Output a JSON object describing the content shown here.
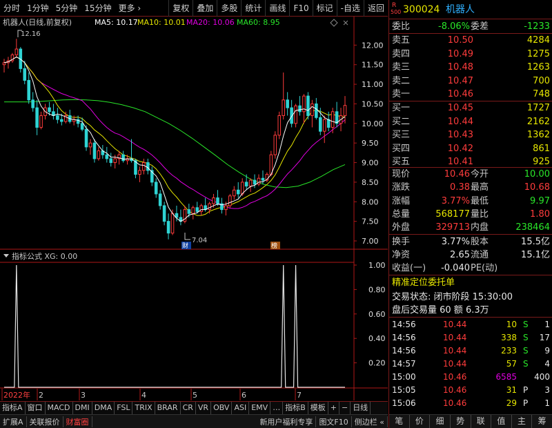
{
  "toolbar": {
    "left": [
      "分时",
      "1分钟",
      "5分钟",
      "15分钟",
      "更多 ›"
    ],
    "right": [
      "复权",
      "叠加",
      "多股",
      "统计",
      "画线",
      "F10",
      "标记",
      "-自选",
      "返回"
    ]
  },
  "chart": {
    "title": "机器人(日线,前复权)",
    "ma_labels": [
      {
        "text": "MA5: 10.17",
        "color": "#ffffff"
      },
      {
        "text": "MA10: 10.01",
        "color": "#e6e600"
      },
      {
        "text": "MA20: 10.06",
        "color": "#e000e0"
      },
      {
        "text": "MA60: 8.95",
        "color": "#29e629"
      }
    ],
    "high_mark": "12.16",
    "low_mark": "7.04",
    "badge1": "财",
    "badge2": "榜",
    "indicator_title": "指标公式 XG: 0.00",
    "price_ticks": [
      "12.00",
      "11.50",
      "11.00",
      "10.50",
      "10.00",
      "9.50",
      "9.00",
      "8.50",
      "8.00",
      "7.50",
      "7.00"
    ],
    "ind_ticks": [
      "1.00",
      "0.80",
      "0.60",
      "0.40",
      "0.20"
    ],
    "date_labels": [
      "2022年",
      "2",
      "3",
      "4",
      "5",
      "6",
      "7"
    ],
    "colors": {
      "up": "#ff3c3c",
      "down": "#2fd3d3",
      "ma5": "#ffffff",
      "ma10": "#e6e600",
      "ma20": "#e000e0",
      "ma60": "#29e629",
      "axis": "#b01818"
    }
  },
  "chart_data": {
    "type": "candlestick",
    "title": "机器人(日线,前复权)",
    "ylim": [
      7.0,
      12.2
    ],
    "candles": [
      [
        11.5,
        11.65,
        11.3,
        11.55
      ],
      [
        11.55,
        11.7,
        11.4,
        11.6
      ],
      [
        11.6,
        11.8,
        11.55,
        11.75
      ],
      [
        11.75,
        12.16,
        11.7,
        11.9
      ],
      [
        11.9,
        11.95,
        11.3,
        11.4
      ],
      [
        11.4,
        11.6,
        11.0,
        11.1
      ],
      [
        11.1,
        11.3,
        10.5,
        10.6
      ],
      [
        10.6,
        10.8,
        10.3,
        10.4
      ],
      [
        10.4,
        10.6,
        9.7,
        9.9
      ],
      [
        9.9,
        10.3,
        9.85,
        10.2
      ],
      [
        10.2,
        10.5,
        10.1,
        10.4
      ],
      [
        10.4,
        10.55,
        10.2,
        10.3
      ],
      [
        10.3,
        10.5,
        10.1,
        10.2
      ],
      [
        10.2,
        10.4,
        10.0,
        10.1
      ],
      [
        10.1,
        10.25,
        9.95,
        10.05
      ],
      [
        10.05,
        10.3,
        10.0,
        10.2
      ],
      [
        10.2,
        10.35,
        10.0,
        10.05
      ],
      [
        10.05,
        10.2,
        9.95,
        10.1
      ],
      [
        10.1,
        10.2,
        9.9,
        10.0
      ],
      [
        10.0,
        10.15,
        9.8,
        9.85
      ],
      [
        9.85,
        9.95,
        9.3,
        9.4
      ],
      [
        9.4,
        9.6,
        9.2,
        9.5
      ],
      [
        9.5,
        9.6,
        9.0,
        9.1
      ],
      [
        9.1,
        9.4,
        9.05,
        9.3
      ],
      [
        9.3,
        9.45,
        9.1,
        9.2
      ],
      [
        9.2,
        9.4,
        9.0,
        9.1
      ],
      [
        9.1,
        9.25,
        8.9,
        9.0
      ],
      [
        9.0,
        9.2,
        8.85,
        9.1
      ],
      [
        9.1,
        9.3,
        8.95,
        9.2
      ],
      [
        9.2,
        9.3,
        9.0,
        9.05
      ],
      [
        9.05,
        9.2,
        8.95,
        9.1
      ],
      [
        9.1,
        9.6,
        9.0,
        9.05
      ],
      [
        9.05,
        9.1,
        8.6,
        8.7
      ],
      [
        8.7,
        8.9,
        8.5,
        8.8
      ],
      [
        8.8,
        9.1,
        8.7,
        9.0
      ],
      [
        9.0,
        9.1,
        8.7,
        8.8
      ],
      [
        8.8,
        8.9,
        8.4,
        8.5
      ],
      [
        8.5,
        8.6,
        8.1,
        8.2
      ],
      [
        8.2,
        8.3,
        7.8,
        7.9
      ],
      [
        7.9,
        8.0,
        7.4,
        7.5
      ],
      [
        7.5,
        7.7,
        7.04,
        7.2
      ],
      [
        7.2,
        7.8,
        7.15,
        7.7
      ],
      [
        7.7,
        7.9,
        7.5,
        7.6
      ],
      [
        7.6,
        7.8,
        7.4,
        7.5
      ],
      [
        7.5,
        7.9,
        7.45,
        7.8
      ],
      [
        7.8,
        7.95,
        7.6,
        7.7
      ],
      [
        7.7,
        7.9,
        7.55,
        7.85
      ],
      [
        7.85,
        8.0,
        7.7,
        7.75
      ],
      [
        7.75,
        7.95,
        7.65,
        7.9
      ],
      [
        7.9,
        8.1,
        7.75,
        7.8
      ],
      [
        7.8,
        8.0,
        7.7,
        7.95
      ],
      [
        7.95,
        8.2,
        7.85,
        8.1
      ],
      [
        8.1,
        8.3,
        7.9,
        7.95
      ],
      [
        7.95,
        8.1,
        7.7,
        7.8
      ],
      [
        7.8,
        8.0,
        7.65,
        7.9
      ],
      [
        7.9,
        8.2,
        7.85,
        8.15
      ],
      [
        8.15,
        8.4,
        8.05,
        8.3
      ],
      [
        8.3,
        8.5,
        8.1,
        8.2
      ],
      [
        8.2,
        8.6,
        8.15,
        8.5
      ],
      [
        8.5,
        8.7,
        8.3,
        8.4
      ],
      [
        8.4,
        8.6,
        8.25,
        8.55
      ],
      [
        8.55,
        8.7,
        8.35,
        8.45
      ],
      [
        8.45,
        8.7,
        8.4,
        8.6
      ],
      [
        8.6,
        8.8,
        8.45,
        8.55
      ],
      [
        8.55,
        8.75,
        8.5,
        8.7
      ],
      [
        8.7,
        9.3,
        8.65,
        9.2
      ],
      [
        9.2,
        9.8,
        9.1,
        9.7
      ],
      [
        9.7,
        10.3,
        9.6,
        10.2
      ],
      [
        10.2,
        11.3,
        10.1,
        10.6
      ],
      [
        10.6,
        10.8,
        10.2,
        10.4
      ],
      [
        10.4,
        10.6,
        9.9,
        10.0
      ],
      [
        10.0,
        10.5,
        9.9,
        10.45
      ],
      [
        10.45,
        10.7,
        10.2,
        10.3
      ],
      [
        10.3,
        10.75,
        10.0,
        10.7
      ],
      [
        10.7,
        10.8,
        10.1,
        10.2
      ],
      [
        10.2,
        10.6,
        9.9,
        10.5
      ],
      [
        10.5,
        10.65,
        10.1,
        10.15
      ],
      [
        10.15,
        10.4,
        9.7,
        9.8
      ],
      [
        9.8,
        10.2,
        9.5,
        10.1
      ],
      [
        10.1,
        10.3,
        9.8,
        9.9
      ],
      [
        9.9,
        10.4,
        9.75,
        10.3
      ],
      [
        10.3,
        10.55,
        9.9,
        10.0
      ],
      [
        10.0,
        10.4,
        9.8,
        10.2
      ],
      [
        10.2,
        10.7,
        10.0,
        10.46
      ]
    ],
    "ma60": [
      10.55,
      10.55,
      10.55,
      10.56,
      10.58,
      10.6,
      10.61,
      10.6,
      10.58,
      10.54,
      10.48,
      10.4,
      10.3,
      10.15,
      10.0,
      9.82,
      9.62,
      9.4,
      9.18,
      8.95,
      8.75,
      8.57,
      8.45,
      8.38,
      8.36,
      8.4,
      8.5,
      8.65,
      8.82,
      8.95
    ],
    "indicator_xg": [
      {
        "index": 3,
        "value": 1.0
      },
      {
        "index": 68,
        "value": 1.0
      },
      {
        "index": 71,
        "value": 1.0
      }
    ]
  },
  "tabs": [
    "指标A",
    "窗口",
    "MACD",
    "DMI",
    "DMA",
    "FSL",
    "TRIX",
    "BRAR",
    "CR",
    "VR",
    "OBV",
    "ASI",
    "EMV",
    "…",
    "指标B",
    "模板",
    "+",
    "−",
    "日线"
  ],
  "statusbar": {
    "left": [
      "扩展A",
      "关联报价",
      "财富圈"
    ],
    "right": [
      "新用户福利专享",
      "图文F10",
      "侧边栏 «"
    ]
  },
  "panel": {
    "logo": "R",
    "logo_sub": "500",
    "code": "300024",
    "name": "机器人",
    "weibi_label": "委比",
    "weibi": "-8.06%",
    "weicha_label": "委差",
    "weicha": "-1233",
    "asks": [
      {
        "label": "卖五",
        "price": "10.50",
        "vol": "4284"
      },
      {
        "label": "卖四",
        "price": "10.49",
        "vol": "1275"
      },
      {
        "label": "卖三",
        "price": "10.48",
        "vol": "1263"
      },
      {
        "label": "卖二",
        "price": "10.47",
        "vol": "700"
      },
      {
        "label": "卖一",
        "price": "10.46",
        "vol": "748"
      }
    ],
    "bids": [
      {
        "label": "买一",
        "price": "10.45",
        "vol": "1727"
      },
      {
        "label": "买二",
        "price": "10.44",
        "vol": "2162"
      },
      {
        "label": "买三",
        "price": "10.43",
        "vol": "1362"
      },
      {
        "label": "买四",
        "price": "10.42",
        "vol": "861"
      },
      {
        "label": "买五",
        "price": "10.41",
        "vol": "925"
      }
    ],
    "quote": [
      {
        "l1": "现价",
        "v1": "10.46",
        "c1": "red",
        "l2": "今开",
        "v2": "10.00",
        "c2": "grn"
      },
      {
        "l1": "涨跌",
        "v1": "0.38",
        "c1": "red",
        "l2": "最高",
        "v2": "10.68",
        "c2": "red"
      },
      {
        "l1": "涨幅",
        "v1": "3.77%",
        "c1": "red",
        "l2": "最低",
        "v2": "9.97",
        "c2": "grn"
      },
      {
        "l1": "总量",
        "v1": "568177",
        "c1": "yel",
        "l2": "量比",
        "v2": "1.80",
        "c2": "red"
      },
      {
        "l1": "外盘",
        "v1": "329713",
        "c1": "red",
        "l2": "内盘",
        "v2": "238464",
        "c2": "grn"
      }
    ],
    "stats": [
      {
        "l1": "换手",
        "v1": "3.77%",
        "l2": "股本",
        "v2": "15.5亿"
      },
      {
        "l1": "净资",
        "v1": "2.65",
        "l2": "流通",
        "v2": "15.1亿"
      },
      {
        "l1": "收益(一)",
        "v1": "-0.040",
        "l2": "PE(动)",
        "v2": ""
      }
    ],
    "precise_title": "精准定位委托单",
    "trade_status": "交易状态: 闭市阶段 15:30:00",
    "after_hours": "盘后交易量 60 额 6.3万",
    "trades": [
      {
        "t": "14:56",
        "p": "10.44",
        "v": "10",
        "vc": "yel",
        "s": "S",
        "sc": "grn",
        "n": "1"
      },
      {
        "t": "14:56",
        "p": "10.44",
        "v": "338",
        "vc": "yel",
        "s": "S",
        "sc": "grn",
        "n": "17"
      },
      {
        "t": "14:56",
        "p": "10.44",
        "v": "233",
        "vc": "yel",
        "s": "S",
        "sc": "grn",
        "n": "9"
      },
      {
        "t": "14:57",
        "p": "10.44",
        "v": "57",
        "vc": "yel",
        "s": "S",
        "sc": "grn",
        "n": "4"
      },
      {
        "t": "15:00",
        "p": "10.46",
        "v": "6585",
        "vc": "mag",
        "s": "",
        "sc": "wht",
        "n": "400"
      },
      {
        "t": "15:05",
        "p": "10.46",
        "v": "31",
        "vc": "yel",
        "s": "P",
        "sc": "wht",
        "n": "3"
      },
      {
        "t": "15:06",
        "p": "10.46",
        "v": "29",
        "vc": "yel",
        "s": "P",
        "sc": "wht",
        "n": "1"
      }
    ],
    "bottom_tabs": [
      "笔",
      "价",
      "细",
      "势",
      "联",
      "值",
      "主",
      "筹"
    ]
  }
}
